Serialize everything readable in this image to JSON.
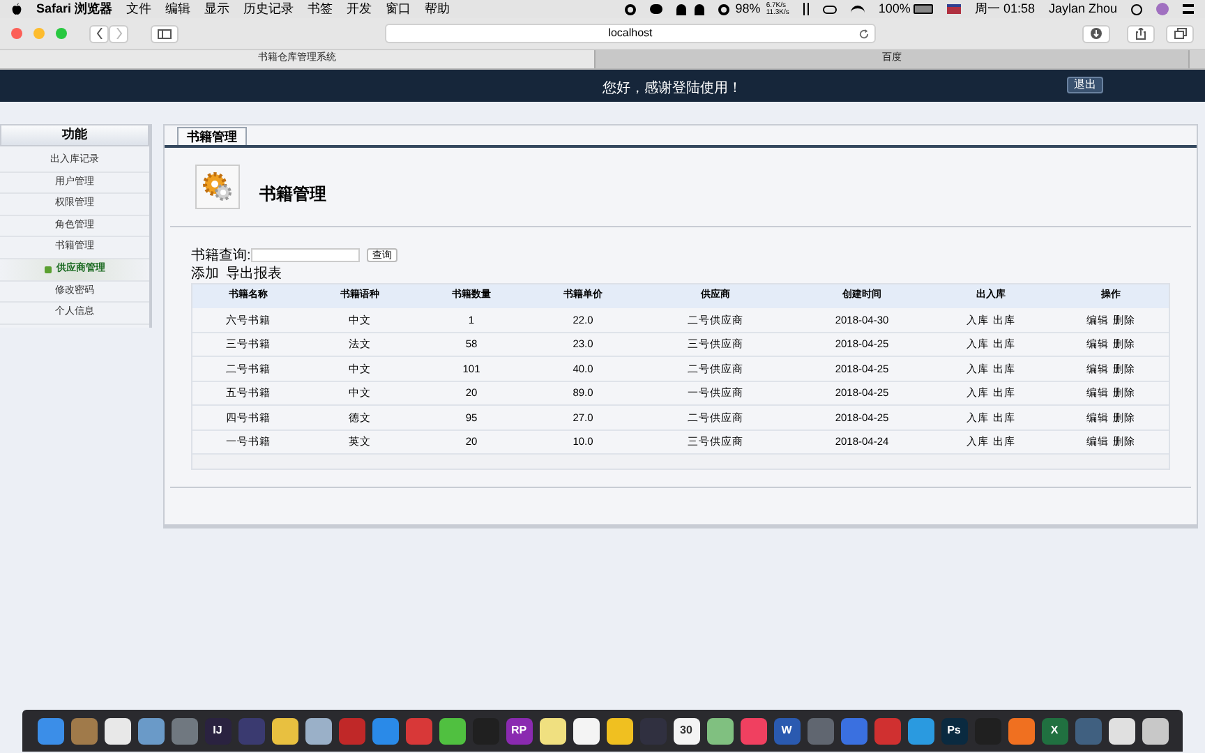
{
  "menubar": {
    "app": "Safari 浏览器",
    "menus": [
      "文件",
      "编辑",
      "显示",
      "历史记录",
      "书签",
      "开发",
      "窗口",
      "帮助"
    ],
    "battery_small": "98%",
    "net_up": "6.7K/s",
    "net_down": "11.3K/s",
    "battery": "100%",
    "clock": "周一 01:58",
    "user": "Jaylan Zhou"
  },
  "browser": {
    "address": "localhost",
    "tabs": [
      {
        "label": "书籍仓库管理系统",
        "selected": true
      },
      {
        "label": "百度",
        "selected": false
      }
    ]
  },
  "banner": {
    "greeting": "您好，感谢登陆使用！",
    "logout": "退出"
  },
  "sidebar": {
    "title": "功能",
    "items": [
      {
        "label": "出入库记录",
        "selected": false
      },
      {
        "label": "用户管理",
        "selected": false
      },
      {
        "label": "权限管理",
        "selected": false
      },
      {
        "label": "角色管理",
        "selected": false
      },
      {
        "label": "书籍管理",
        "selected": false
      },
      {
        "label": "供应商管理",
        "selected": true
      },
      {
        "label": "修改密码",
        "selected": false
      },
      {
        "label": "个人信息",
        "selected": false
      }
    ]
  },
  "main": {
    "tab": "书籍管理",
    "heading": "书籍管理",
    "search_label": "书籍查询:",
    "search_button": "查询",
    "actions": [
      "添加",
      "导出报表"
    ],
    "table": {
      "columns": [
        "书籍名称",
        "书籍语种",
        "书籍数量",
        "书籍单价",
        "供应商",
        "创建时间",
        "出入库",
        "操作"
      ],
      "rows": [
        [
          "六号书籍",
          "中文",
          "1",
          "22.0",
          "二号供应商",
          "2018-04-30",
          [
            "入库",
            "出库"
          ],
          [
            "编辑",
            "删除"
          ]
        ],
        [
          "三号书籍",
          "法文",
          "58",
          "23.0",
          "三号供应商",
          "2018-04-25",
          [
            "入库",
            "出库"
          ],
          [
            "编辑",
            "删除"
          ]
        ],
        [
          "二号书籍",
          "中文",
          "101",
          "40.0",
          "二号供应商",
          "2018-04-25",
          [
            "入库",
            "出库"
          ],
          [
            "编辑",
            "删除"
          ]
        ],
        [
          "五号书籍",
          "中文",
          "20",
          "89.0",
          "一号供应商",
          "2018-04-25",
          [
            "入库",
            "出库"
          ],
          [
            "编辑",
            "删除"
          ]
        ],
        [
          "四号书籍",
          "德文",
          "95",
          "27.0",
          "二号供应商",
          "2018-04-25",
          [
            "入库",
            "出库"
          ],
          [
            "编辑",
            "删除"
          ]
        ],
        [
          "一号书籍",
          "英文",
          "20",
          "10.0",
          "三号供应商",
          "2018-04-24",
          [
            "入库",
            "出库"
          ],
          [
            "编辑",
            "删除"
          ]
        ]
      ]
    }
  },
  "dock": [
    {
      "color": "#3b8ee8"
    },
    {
      "color": "#a07a4a"
    },
    {
      "color": "#e8e8e8"
    },
    {
      "color": "#6a9ac8"
    },
    {
      "color": "#707880"
    },
    {
      "color": "#2a2240",
      "glyph": "IJ"
    },
    {
      "color": "#3a3a70"
    },
    {
      "color": "#e8c040"
    },
    {
      "color": "#9ab0c8"
    },
    {
      "color": "#c02828"
    },
    {
      "color": "#2a8ae8"
    },
    {
      "color": "#d83838"
    },
    {
      "color": "#50c040"
    },
    {
      "color": "#202020"
    },
    {
      "color": "#8a2ab0",
      "glyph": "RP"
    },
    {
      "color": "#f0e080"
    },
    {
      "color": "#f4f4f4"
    },
    {
      "color": "#f0c020"
    },
    {
      "color": "#303040"
    },
    {
      "color": "#f4f4f4",
      "glyph": "30"
    },
    {
      "color": "#80c080"
    },
    {
      "color": "#f04060"
    },
    {
      "color": "#2a5ab0",
      "glyph": "W"
    },
    {
      "color": "#606670"
    },
    {
      "color": "#3a70e0"
    },
    {
      "color": "#d03030"
    },
    {
      "color": "#2a9ae0"
    },
    {
      "color": "#0a2a40",
      "glyph": "Ps"
    },
    {
      "color": "#202020"
    },
    {
      "color": "#f07020"
    },
    {
      "color": "#207040",
      "glyph": "X"
    },
    {
      "color": "#406080"
    },
    {
      "color": "#e0e0e0"
    },
    {
      "color": "#c8c8c8"
    }
  ]
}
